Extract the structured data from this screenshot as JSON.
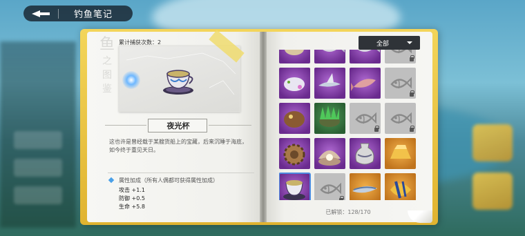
{
  "header": {
    "title": "钓鱼笔记"
  },
  "left_page": {
    "vertical_title": [
      "鱼",
      "之",
      "图",
      "鉴"
    ],
    "catch_count": "累计捕获次数：2",
    "fish_name": "夜光杯",
    "description": "这也许是曾经载于某艘货船上的宝藏，后来沉睡于海底，如今终于重见天日。",
    "attribute_title": "属性加成（所有人偶都可获得属性加成）",
    "attributes": [
      "攻击 +1.1",
      "防御 +0.5",
      "生命 +5.8"
    ]
  },
  "right_page": {
    "filter_label": "全部",
    "unlocked": "已解锁：128/170"
  },
  "grid": [
    {
      "rarity": "purple",
      "icon": "creature-item-icon",
      "state": "unlocked",
      "partial": true
    },
    {
      "rarity": "purple",
      "icon": "fish-item-icon",
      "state": "unlocked",
      "partial": true
    },
    {
      "rarity": "purple",
      "icon": "fish-item-icon",
      "state": "unlocked",
      "partial": true
    },
    {
      "rarity": "locked",
      "icon": "locked-fish-icon",
      "state": "locked",
      "partial": true
    },
    {
      "rarity": "purple",
      "icon": "sea-slug-icon",
      "state": "unlocked"
    },
    {
      "rarity": "purple",
      "icon": "flying-fish-icon",
      "state": "unlocked"
    },
    {
      "rarity": "purple",
      "icon": "salmon-icon",
      "state": "unlocked"
    },
    {
      "rarity": "locked",
      "icon": "locked-fish-icon",
      "state": "locked"
    },
    {
      "rarity": "purple",
      "icon": "rockfish-icon",
      "state": "unlocked"
    },
    {
      "rarity": "green",
      "icon": "spiky-turtle-icon",
      "state": "unlocked"
    },
    {
      "rarity": "locked",
      "icon": "locked-fish-icon",
      "state": "locked"
    },
    {
      "rarity": "locked",
      "icon": "locked-fish-icon",
      "state": "locked"
    },
    {
      "rarity": "purple",
      "icon": "gear-relic-icon",
      "state": "unlocked"
    },
    {
      "rarity": "purple",
      "icon": "pearl-shell-icon",
      "state": "unlocked"
    },
    {
      "rarity": "purple",
      "icon": "vase-icon",
      "state": "unlocked"
    },
    {
      "rarity": "gold",
      "icon": "gold-ingot-icon",
      "state": "unlocked"
    },
    {
      "rarity": "purple",
      "icon": "teacup-icon",
      "state": "selected"
    },
    {
      "rarity": "locked",
      "icon": "locked-fish-icon",
      "state": "locked"
    },
    {
      "rarity": "gold",
      "icon": "sardine-icon",
      "state": "unlocked"
    },
    {
      "rarity": "gold",
      "icon": "tropical-fish-icon",
      "state": "unlocked"
    }
  ],
  "colors": {
    "book_cover": "#e8c23e",
    "accent_blue": "#4c8ae0",
    "purple_rarity": "#8a3fb0",
    "gold_rarity": "#e0922e",
    "green_rarity": "#3b7d44"
  }
}
